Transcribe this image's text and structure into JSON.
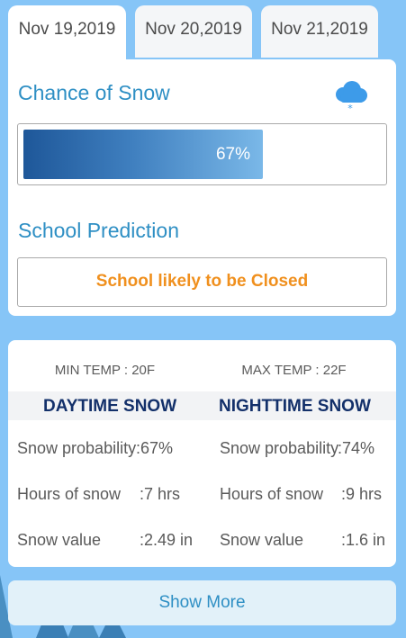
{
  "tabs": [
    {
      "label": "Nov 19,2019"
    },
    {
      "label": "Nov 20,2019"
    },
    {
      "label": "Nov 21,2019"
    }
  ],
  "chance": {
    "title": "Chance of Snow",
    "icon": "snow-cloud-icon",
    "percent_label": "67%",
    "percent_value": 67
  },
  "school": {
    "title": "School Prediction",
    "prediction": "School likely to be Closed"
  },
  "temps": {
    "min": "MIN TEMP : 20F",
    "max": "MAX TEMP : 22F"
  },
  "daytime": {
    "header": "DAYTIME SNOW",
    "rows": [
      {
        "label": "Snow probability",
        "value": ":67%"
      },
      {
        "label": "Hours of snow",
        "value": ":7 hrs"
      },
      {
        "label": "Snow value",
        "value": ":2.49 in"
      }
    ]
  },
  "nighttime": {
    "header": "NIGHTTIME SNOW",
    "rows": [
      {
        "label": "Snow probability",
        "value": ":74%"
      },
      {
        "label": "Hours of snow",
        "value": ":9 hrs"
      },
      {
        "label": "Snow value",
        "value": ":1.6 in"
      }
    ]
  },
  "show_more": "Show More",
  "colors": {
    "background": "#86c5f7",
    "accent": "#2e8fc4",
    "prediction": "#f0901e",
    "header_text": "#13306a"
  }
}
